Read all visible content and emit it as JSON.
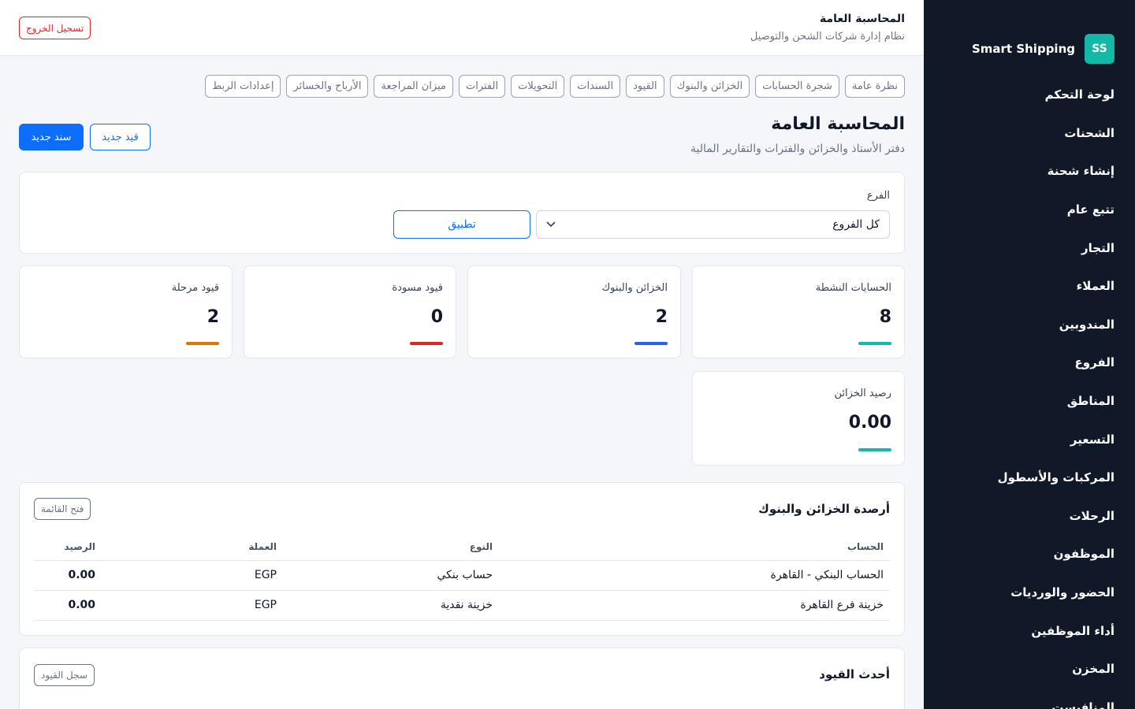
{
  "sidebar": {
    "logo": "SS",
    "brand": "Smart Shipping",
    "items": [
      "لوحة التحكم",
      "الشحنات",
      "إنشاء شحنة",
      "تتبع عام",
      "التجار",
      "العملاء",
      "المندوبين",
      "الفروع",
      "المناطق",
      "التسعير",
      "المركبات والأسطول",
      "الرحلات",
      "الموظفون",
      "الحضور والورديات",
      "أداء الموظفين",
      "المخزن",
      "المنافيست"
    ]
  },
  "header": {
    "title": "المحاسبة العامة",
    "subtitle": "نظام إدارة شركات الشحن والتوصيل",
    "logout": "تسجيل الخروج"
  },
  "tabs": [
    "نظرة عامة",
    "شجرة الحسابات",
    "الخزائن والبنوك",
    "القيود",
    "السندات",
    "التحويلات",
    "الفترات",
    "ميزان المراجعة",
    "الأرباح والخسائر",
    "إعدادات الربط"
  ],
  "page": {
    "title": "المحاسبة العامة",
    "subtitle": "دفتر الأستاذ والخزائن والفترات والتقارير المالية",
    "new_voucher": "سند جديد",
    "new_entry": "قيد جديد"
  },
  "filter": {
    "label": "الفرع",
    "selected": "كل الفروع",
    "apply": "تطبيق"
  },
  "stats": [
    {
      "label": "الحسابات النشطة",
      "value": "8",
      "color": "#14b8a6"
    },
    {
      "label": "الخزائن والبنوك",
      "value": "2",
      "color": "#2563eb"
    },
    {
      "label": "قيود مسودة",
      "value": "0",
      "color": "#dc2626"
    },
    {
      "label": "قيود مرحلة",
      "value": "2",
      "color": "#d97706"
    },
    {
      "label": "رصيد الخزائن",
      "value": "0.00",
      "color": "#14b8a6"
    }
  ],
  "balances": {
    "title": "أرصدة الخزائن والبنوك",
    "open_list": "فتح القائمة",
    "columns": [
      "الحساب",
      "النوع",
      "العملة",
      "الرصيد"
    ],
    "rows": [
      {
        "account": "الحساب البنكي - القاهرة",
        "type": "حساب بنكي",
        "currency": "EGP",
        "balance": "0.00"
      },
      {
        "account": "خزينة فرع القاهرة",
        "type": "خزينة نقدية",
        "currency": "EGP",
        "balance": "0.00"
      }
    ]
  },
  "recent": {
    "title": "أحدث القيود",
    "log": "سجل القيود"
  }
}
